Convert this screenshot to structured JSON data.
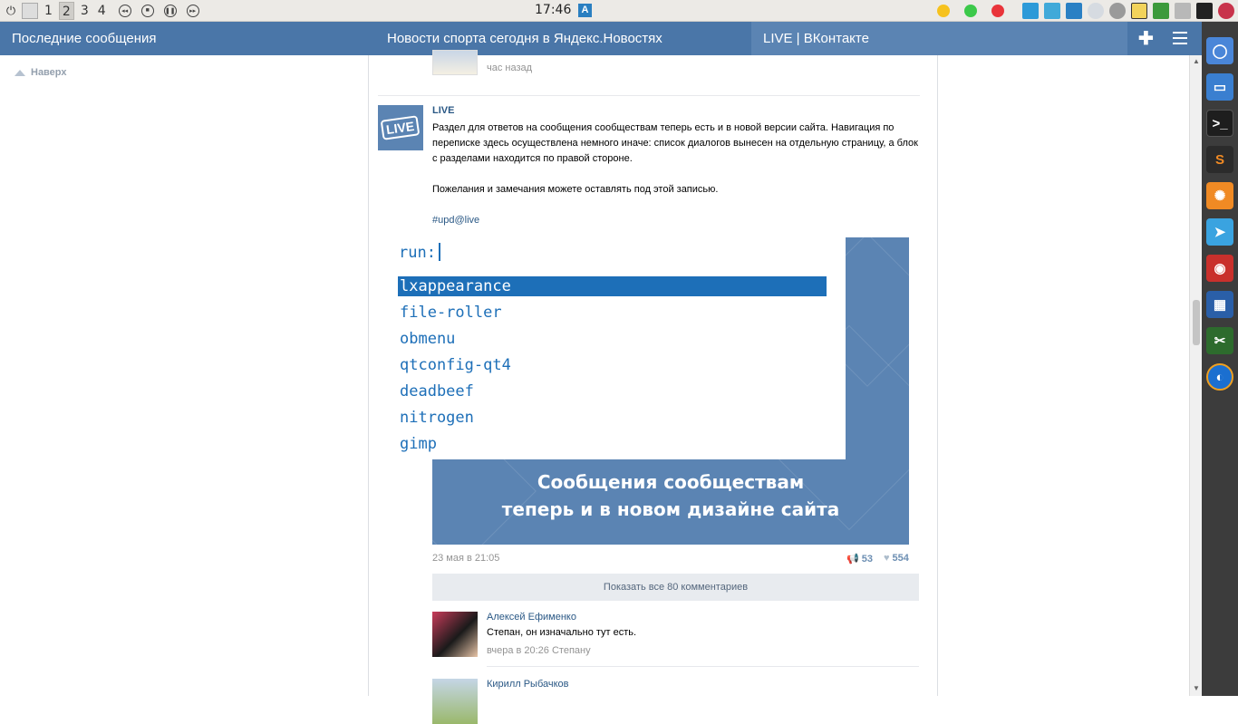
{
  "system_panel": {
    "workspaces": [
      "1",
      "2",
      "3",
      "4"
    ],
    "active_workspace": "2",
    "clock": "17:46",
    "distro_logo": "arch-icon",
    "media_buttons": [
      "prev-icon",
      "stop-icon",
      "pause-icon",
      "next-icon"
    ],
    "tray_dots": [
      "#f6c21e",
      "#3cc94a",
      "#e9343a"
    ]
  },
  "header": {
    "left_title": "Последние сообщения",
    "center_title": "Новости спорта сегодня в Яндекс.Новостях",
    "right_title": "LIVE | ВКонтакте",
    "plus_label": "✚"
  },
  "page": {
    "up_label": "Наверх",
    "top_time": "час назад",
    "post": {
      "author": "LIVE",
      "paragraph1": "Раздел для ответов на сообщения сообществам теперь есть и в новой версии сайта. Навигация по переписке здесь осуществлена немного иначе: список диалогов вынесен на отдельную страницу, а блок с разделами находится по правой стороне.",
      "paragraph2": "Пожелания и замечания можете оставлять под этой записью.",
      "hashtag": "#upd@live",
      "image_line1": "Сообщения сообществам",
      "image_line2": "теперь и в новом дизайне сайта",
      "date": "23 мая в 21:05",
      "reposts": "53",
      "likes": "554",
      "show_all": "Показать все 80 комментариев"
    },
    "comments": [
      {
        "name": "Алексей Ефименко",
        "text": "Степан, он изначально тут есть.",
        "meta": "вчера в 20:26 Степану"
      },
      {
        "name": "Кирилл Рыбачков",
        "text": "",
        "meta": ""
      }
    ]
  },
  "run_dialog": {
    "prompt": "run:",
    "items": [
      "lxappearance",
      "file-roller",
      "obmenu",
      "qtconfig-qt4",
      "deadbeef",
      "nitrogen",
      "gimp"
    ],
    "selected_index": 0
  },
  "colors": {
    "vk_blue": "#4a76a8",
    "link": "#2a5885",
    "run_accent": "#1d6fb8"
  },
  "dock": [
    "chromium-icon",
    "files-icon",
    "terminal-icon",
    "sublime-icon",
    "orange-icon",
    "telegram-icon",
    "transmission-icon",
    "calculator-icon",
    "inkscape-icon",
    "browser-icon"
  ]
}
